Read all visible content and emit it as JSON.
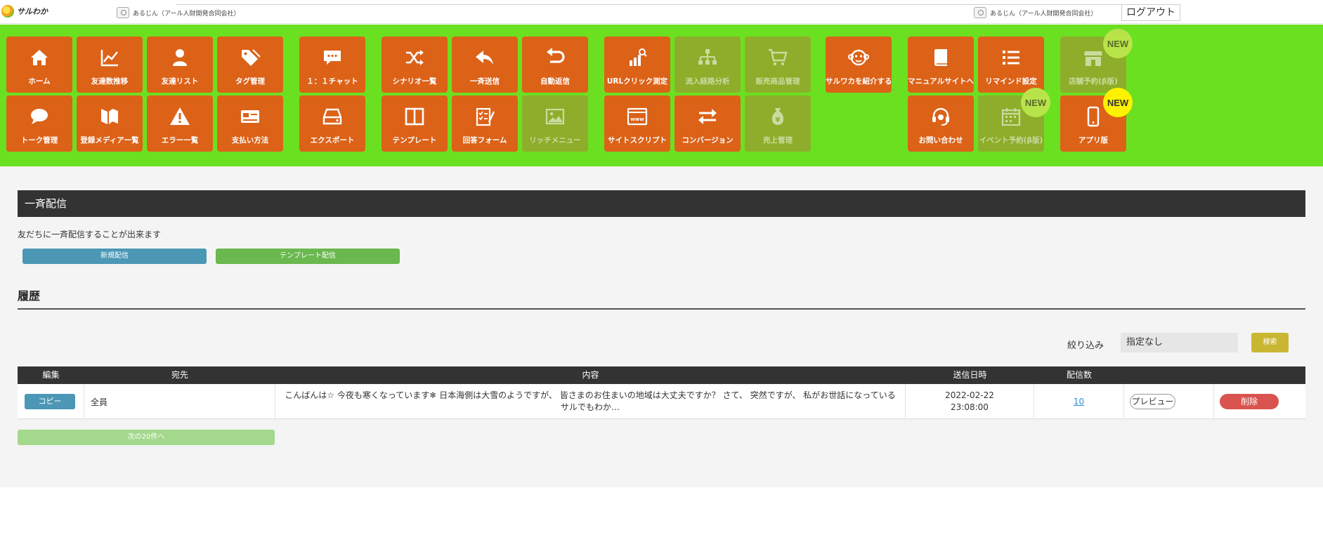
{
  "header": {
    "logo_text": "サルわか",
    "account_left": "あるじん（アール人財開発合同会社）",
    "account_right": "あるじん（アール人財開発合同会社）",
    "logout_label": "ログアウト"
  },
  "nav": {
    "tiles": [
      {
        "label": "ホーム",
        "icon": "home-icon"
      },
      {
        "label": "友達数推移",
        "icon": "chart-line-icon"
      },
      {
        "label": "友達リスト",
        "icon": "user-icon"
      },
      {
        "label": "タグ管理",
        "icon": "tag-icon"
      },
      {
        "label": "１：１チャット",
        "icon": "chat-bubble-icon"
      },
      {
        "label": "シナリオ一覧",
        "icon": "shuffle-icon"
      },
      {
        "label": "一斉送信",
        "icon": "reply-icon"
      },
      {
        "label": "自動返信",
        "icon": "undo-icon"
      },
      {
        "label": "URLクリック測定",
        "icon": "bar-chart-search-icon"
      },
      {
        "label": "流入経路分析",
        "icon": "sitemap-icon"
      },
      {
        "label": "販売商品管理",
        "icon": "cart-icon"
      },
      {
        "label": "サルワカを紹介する",
        "icon": "monkey-icon"
      },
      {
        "label": "マニュアルサイトへ",
        "icon": "book-icon"
      },
      {
        "label": "リマインド設定",
        "icon": "list-icon"
      },
      {
        "label": "店舗予約(β版)",
        "icon": "store-icon"
      },
      {
        "label": "トーク管理",
        "icon": "comment-icon"
      },
      {
        "label": "登録メディア一覧",
        "icon": "media-icon"
      },
      {
        "label": "エラー一覧",
        "icon": "warning-icon"
      },
      {
        "label": "支払い方法",
        "icon": "credit-card-icon"
      },
      {
        "label": "エクスポート",
        "icon": "drive-icon"
      },
      {
        "label": "テンプレート",
        "icon": "columns-icon"
      },
      {
        "label": "回答フォーム",
        "icon": "form-icon"
      },
      {
        "label": "リッチメニュー",
        "icon": "image-icon"
      },
      {
        "label": "サイトスクリプト",
        "icon": "browser-icon"
      },
      {
        "label": "コンバージョン",
        "icon": "exchange-icon"
      },
      {
        "label": "売上管理",
        "icon": "money-bag-icon"
      },
      {
        "label": "お問い合わせ",
        "icon": "headset-icon"
      },
      {
        "label": "イベント予約(β版)",
        "icon": "calendar-icon"
      },
      {
        "label": "アプリ版",
        "icon": "mobile-icon"
      }
    ],
    "badge_new": "NEW"
  },
  "page": {
    "title": "一斉配信",
    "description": "友だちに一斉配信することが出来ます",
    "new_button": "新規配信",
    "template_button": "テンプレート配信",
    "history_title": "履歴",
    "filter_label": "絞り込み",
    "filter_value": "指定なし",
    "search_button": "検索",
    "next_button": "次の20件へ"
  },
  "table": {
    "headers": {
      "edit": "編集",
      "dest": "宛先",
      "content": "内容",
      "date": "送信日時",
      "count": "配信数"
    },
    "rows": [
      {
        "copy": "コピー",
        "dest": "全員",
        "content": "こんばんは☆ 今夜も寒くなっています❄ 日本海側は大雪のようですが、 皆さまのお住まいの地域は大丈夫ですか？ さて、 突然ですが、 私がお世話になっている サルでもわか…",
        "date_line1": "2022-02-22",
        "date_line2": "23:08:00",
        "count": "10",
        "preview": "プレビュー",
        "delete": "削除"
      }
    ]
  },
  "colors": {
    "nav_bg": "#6be021",
    "tile": "#dc6218",
    "tile_disabled": "#8eae2b",
    "header_dark": "#333333"
  }
}
